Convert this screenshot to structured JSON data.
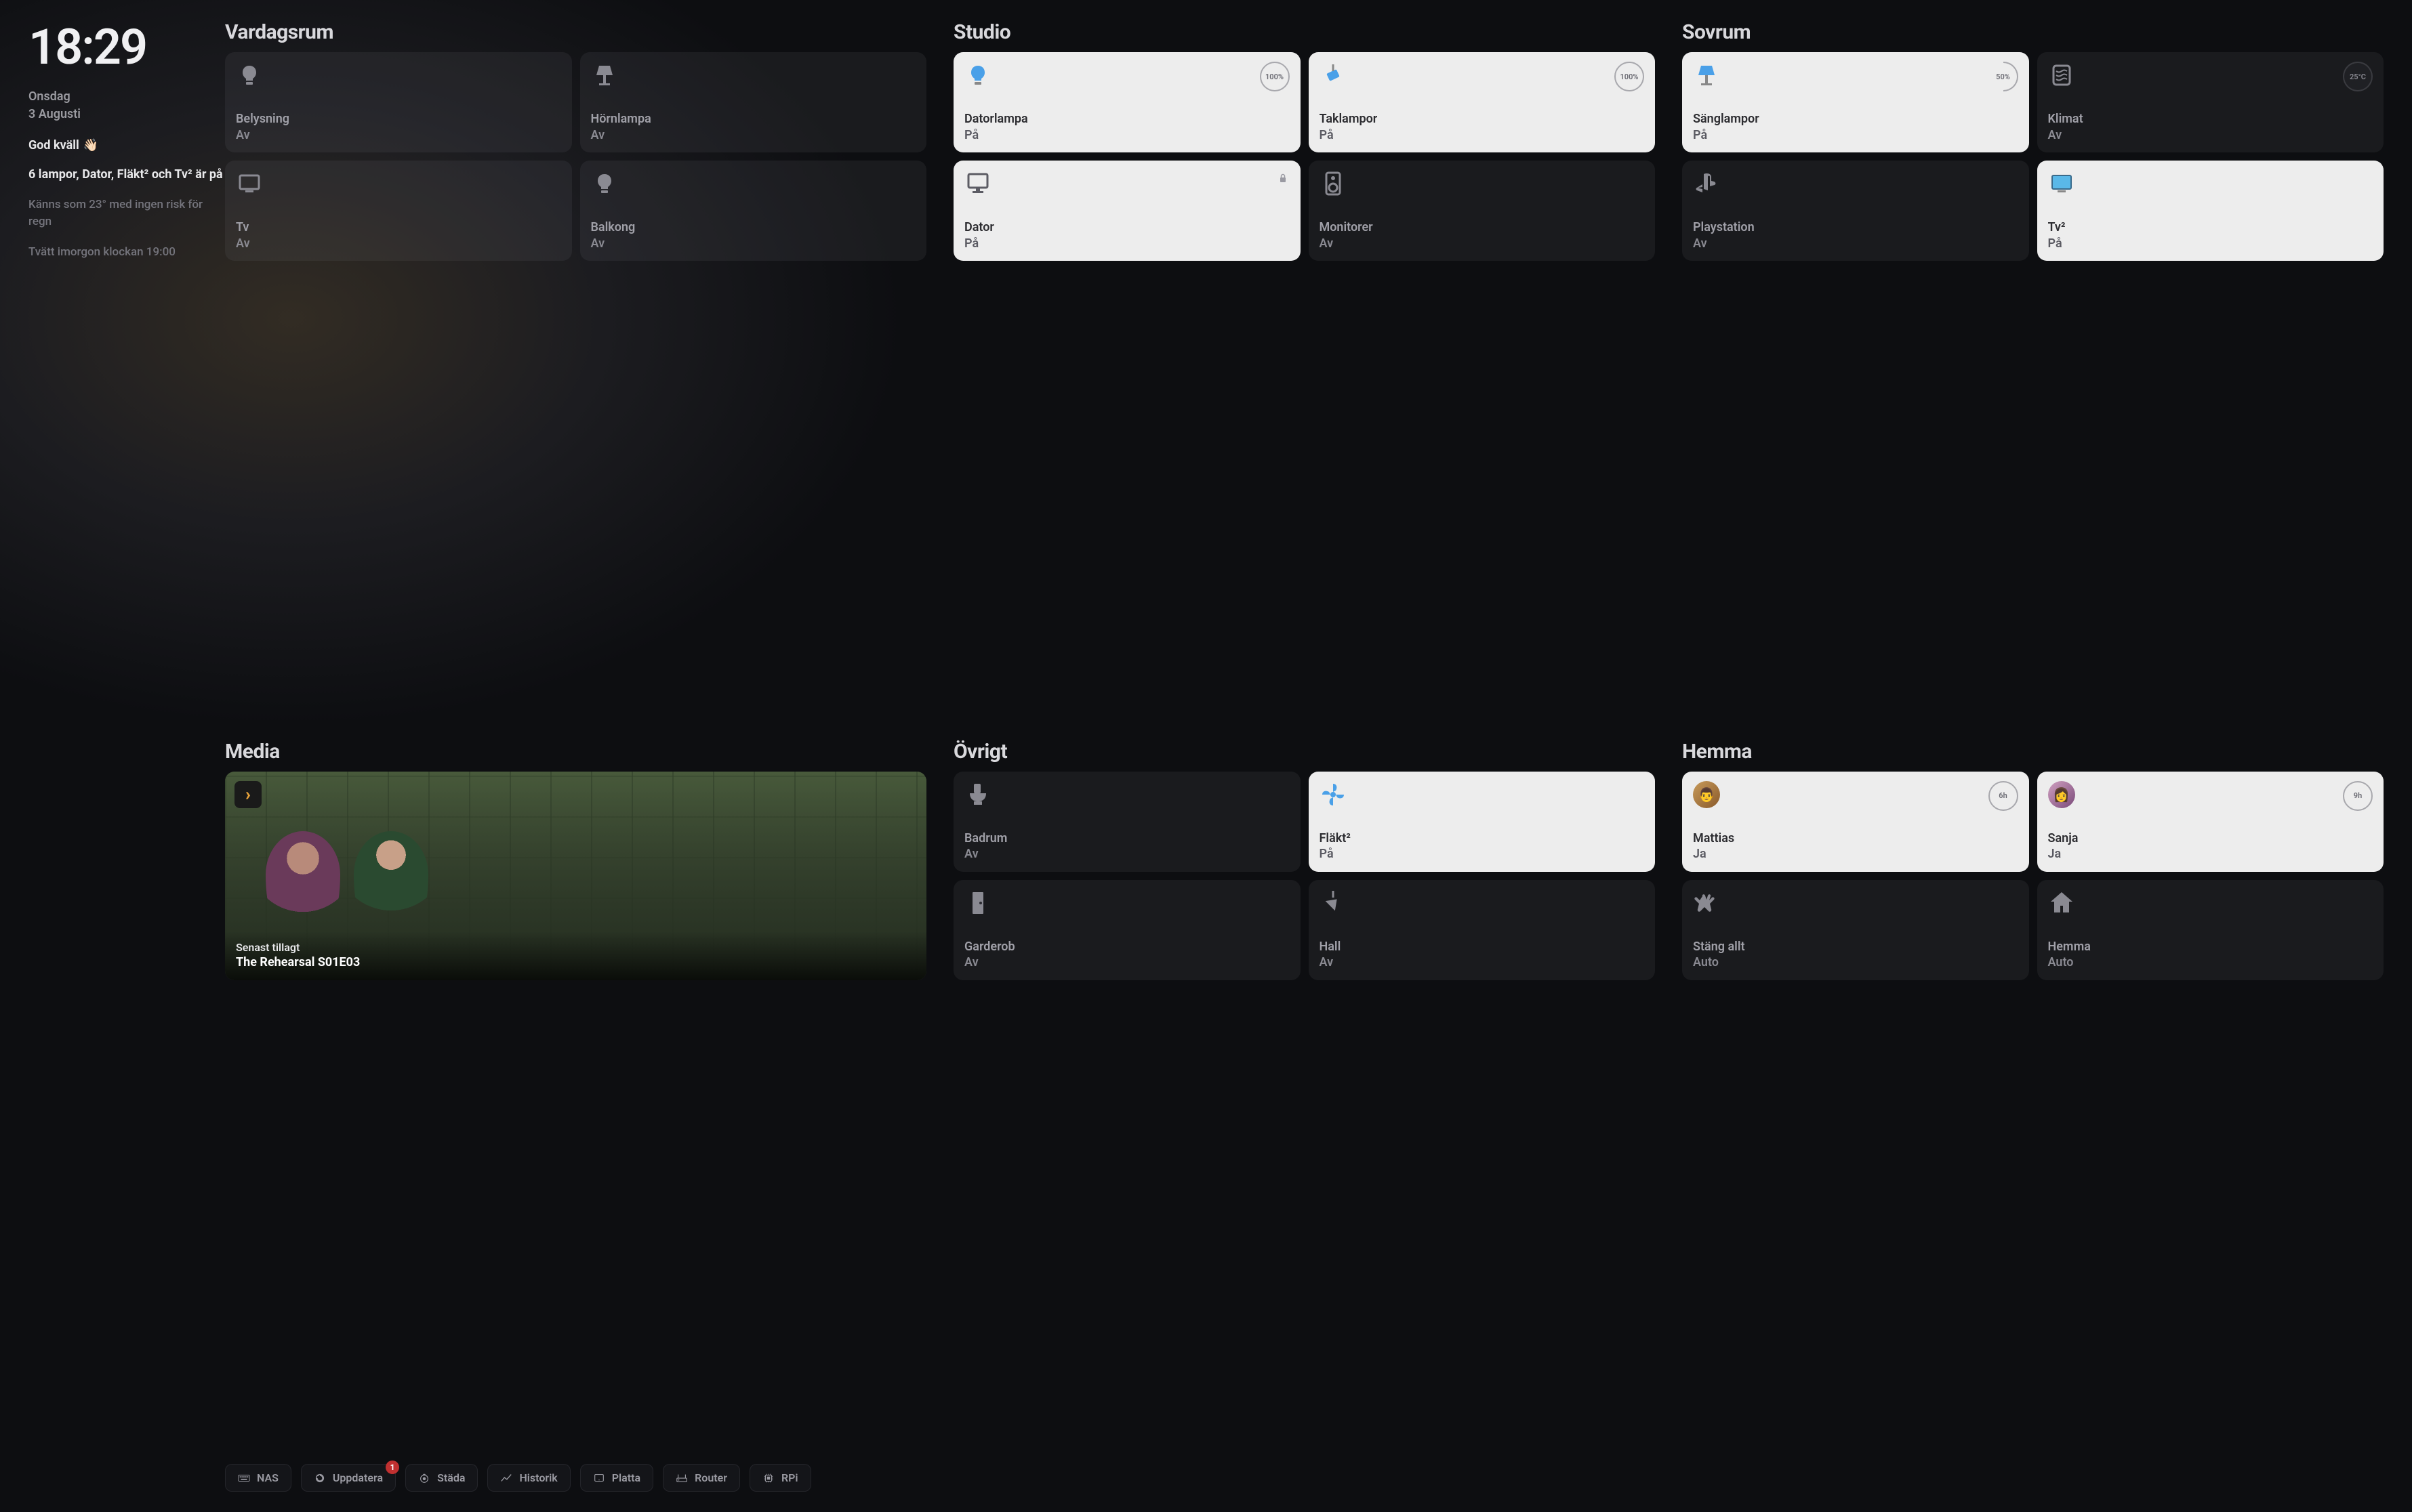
{
  "clock": "18:29",
  "date_line1": "Onsdag",
  "date_line2": "3 Augusti",
  "greeting": "God kväll",
  "greeting_emoji": "👋🏻",
  "summary": "6 lampor, Dator, Fläkt² och Tv² är på",
  "weather": "Känns som 23° med ingen risk för regn",
  "reminder": "Tvätt imorgon klockan 19:00",
  "sections": {
    "vardagsrum": {
      "title": "Vardagsrum",
      "tiles": [
        {
          "name": "Belysning",
          "state": "Av",
          "icon": "bulb",
          "on": false
        },
        {
          "name": "Hörnlampa",
          "state": "Av",
          "icon": "lamp",
          "on": false
        },
        {
          "name": "Tv",
          "state": "Av",
          "icon": "tv",
          "on": false
        },
        {
          "name": "Balkong",
          "state": "Av",
          "icon": "bulb",
          "on": false
        }
      ]
    },
    "studio": {
      "title": "Studio",
      "tiles": [
        {
          "name": "Datorlampa",
          "state": "På",
          "icon": "bulb-blue",
          "on": true,
          "badge": "100%"
        },
        {
          "name": "Taklampor",
          "state": "På",
          "icon": "spot-blue",
          "on": true,
          "badge": "100%"
        },
        {
          "name": "Dator",
          "state": "På",
          "icon": "imac",
          "on": true,
          "lock": true
        },
        {
          "name": "Monitorer",
          "state": "Av",
          "icon": "speaker",
          "on": false
        }
      ]
    },
    "sovrum": {
      "title": "Sovrum",
      "tiles": [
        {
          "name": "Sänglampor",
          "state": "På",
          "icon": "lamp-blue",
          "on": true,
          "badge": "50%",
          "partial": true
        },
        {
          "name": "Klimat",
          "state": "Av",
          "icon": "climate",
          "on": false,
          "badge": "25°C",
          "temp": true
        },
        {
          "name": "Playstation",
          "state": "Av",
          "icon": "ps",
          "on": false
        },
        {
          "name": "Tv²",
          "state": "På",
          "icon": "tv-blue",
          "on": true
        }
      ]
    },
    "ovrigt": {
      "title": "Övrigt",
      "tiles": [
        {
          "name": "Badrum",
          "state": "Av",
          "icon": "toilet",
          "on": false
        },
        {
          "name": "Fläkt²",
          "state": "På",
          "icon": "fan-blue",
          "on": true
        },
        {
          "name": "Garderob",
          "state": "Av",
          "icon": "door",
          "on": false
        },
        {
          "name": "Hall",
          "state": "Av",
          "icon": "pendant",
          "on": false
        }
      ]
    },
    "hemma": {
      "title": "Hemma",
      "tiles": [
        {
          "name": "Mattias",
          "state": "Ja",
          "icon": "avatar-m",
          "on": true,
          "badge": "6h"
        },
        {
          "name": "Sanja",
          "state": "Ja",
          "icon": "avatar-s",
          "on": true,
          "badge": "9h"
        },
        {
          "name": "Stäng allt",
          "state": "Auto",
          "icon": "clap",
          "on": false
        },
        {
          "name": "Hemma",
          "state": "Auto",
          "icon": "home",
          "on": false
        }
      ]
    }
  },
  "media": {
    "title": "Media",
    "service": "plex",
    "subtitle": "Senast tillagt",
    "item": "The Rehearsal S01E03"
  },
  "footer": [
    {
      "icon": "keyboard",
      "label": "NAS"
    },
    {
      "icon": "refresh",
      "label": "Uppdatera",
      "badge": "1"
    },
    {
      "icon": "vacuum",
      "label": "Städa"
    },
    {
      "icon": "chart",
      "label": "Historik"
    },
    {
      "icon": "tablet",
      "label": "Platta"
    },
    {
      "icon": "router",
      "label": "Router"
    },
    {
      "icon": "chip",
      "label": "RPi"
    }
  ],
  "colors": {
    "accent_blue": "#4aa0e8",
    "on_bg": "#ededed",
    "off_bg": "rgba(120,120,130,0.12)",
    "badge_red": "#c03030"
  }
}
